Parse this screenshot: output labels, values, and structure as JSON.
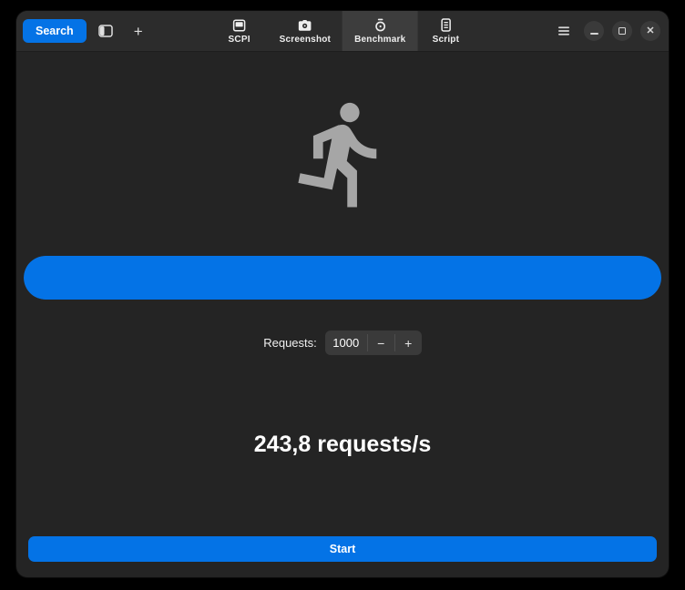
{
  "header": {
    "search_button": "Search",
    "tabs": [
      {
        "label": "SCPI"
      },
      {
        "label": "Screenshot"
      },
      {
        "label": "Benchmark",
        "active": true
      },
      {
        "label": "Script"
      }
    ]
  },
  "benchmark": {
    "requests_label": "Requests:",
    "requests_value": "1000",
    "spin_decrement": "−",
    "spin_increment": "+",
    "result_text": "243,8 requests/s",
    "progress_percent": 100,
    "progress_style": "width:100%",
    "start_button": "Start"
  },
  "icons": {
    "sidebar-toggle-icon": "split-panel-shape",
    "new-tab-icon": "+",
    "display-icon": "instrument-display-shape",
    "camera-icon": "camera-shape",
    "stopwatch-icon": "stopwatch-shape",
    "script-icon": "document-lines-shape",
    "menu-icon": "hamburger-lines",
    "minimize-icon": "−",
    "maximize-icon": "square-outline",
    "close-icon": "✕",
    "runner-icon": "running-person-shape"
  },
  "colors": {
    "accent": "#0473e6",
    "window_bg": "#242424",
    "header_bg": "#2c2c2c",
    "active_tab_bg": "#3d3d3d",
    "control_bg": "#3a3a3a",
    "runner_gray": "#a6a6a6"
  }
}
